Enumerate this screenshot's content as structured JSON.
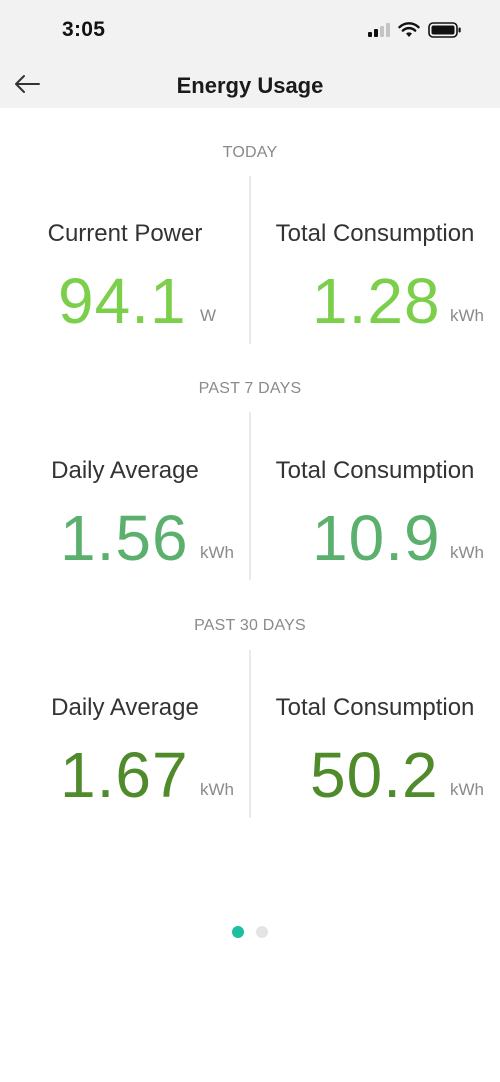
{
  "status_bar": {
    "time": "3:05"
  },
  "header": {
    "title": "Energy Usage"
  },
  "sections": [
    {
      "label": "TODAY",
      "left": {
        "label": "Current Power",
        "value": "94.1",
        "unit": "W"
      },
      "right": {
        "label": "Total Consumption",
        "value": "1.28",
        "unit": "kWh"
      }
    },
    {
      "label": "PAST 7 DAYS",
      "left": {
        "label": "Daily Average",
        "value": "1.56",
        "unit": "kWh"
      },
      "right": {
        "label": "Total Consumption",
        "value": "10.9",
        "unit": "kWh"
      }
    },
    {
      "label": "PAST 30 DAYS",
      "left": {
        "label": "Daily Average",
        "value": "1.67",
        "unit": "kWh"
      },
      "right": {
        "label": "Total Consumption",
        "value": "50.2",
        "unit": "kWh"
      }
    }
  ],
  "colors": {
    "today": "#7ccf4a",
    "past_7_days": "#5cb06e",
    "past_30_days": "#4f8a2b",
    "page_indicator_active": "#1dbf9f"
  },
  "pager": {
    "pages": 2,
    "active_page": 1
  },
  "icons": {
    "back": "arrow-left-icon",
    "signal": "cellular-signal-icon",
    "wifi": "wifi-icon",
    "battery": "battery-icon"
  }
}
